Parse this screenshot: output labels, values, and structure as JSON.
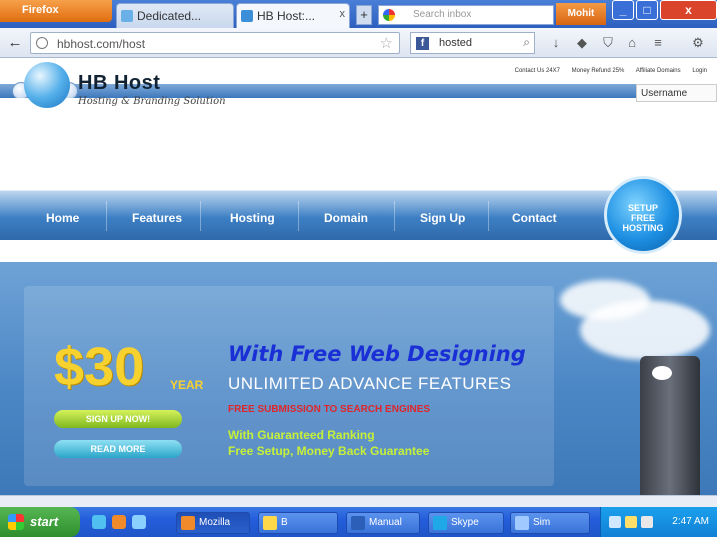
{
  "browser": {
    "firefox_label": "Firefox",
    "tabs": [
      {
        "label": "Dedicated..."
      },
      {
        "label": "HB Host:..."
      }
    ],
    "tab_close": "x",
    "new_tab": "+",
    "tab_search_placeholder": "Search inbox",
    "orange_button": "Mohit",
    "window_controls": [
      "_",
      "□",
      "x"
    ],
    "url": "hbhost.com/host",
    "search_value": "hosted",
    "colors": {
      "tabstrip": "#2e5fbf",
      "firefox_orange": "#e06d10"
    }
  },
  "site": {
    "top_links": [
      "Contact Us 24X7",
      "Money Refund 25%",
      "Affiliate Domains",
      "Login"
    ],
    "logo_title": "HB Host",
    "logo_subtitle": "Hosting & Branding Solution",
    "username_label": "Username",
    "menu": [
      "Home",
      "Features",
      "Hosting",
      "Domain",
      "Sign Up",
      "Contact"
    ],
    "setup_badge": "SETUP\nFREE\nHOSTING",
    "banner": {
      "price": "$30",
      "period": "YEAR",
      "signup_button": "SIGN UP NOW!",
      "readmore_button": "READ MORE",
      "headline": "With Free Web Designing",
      "features": "UNLIMITED ADVANCE FEATURES",
      "submission": "FREE SUBMISSION TO SEARCH ENGINES",
      "guarantee_1": "With Guaranteed Ranking",
      "guarantee_2": "Free Setup, Money Back Guarantee"
    },
    "colors": {
      "menu_blue": "#3d7fc4",
      "price_yellow": "#f7d12e",
      "headline_blue": "#1a2fd6",
      "red": "#e0262a",
      "green": "#c6f038"
    }
  },
  "taskbar": {
    "start": "start",
    "tasks": [
      {
        "label": "Mozilla"
      },
      {
        "label": "B"
      },
      {
        "label": "Manual"
      },
      {
        "label": "Skype"
      },
      {
        "label": "Sim"
      }
    ],
    "clock": "2:47 AM"
  }
}
